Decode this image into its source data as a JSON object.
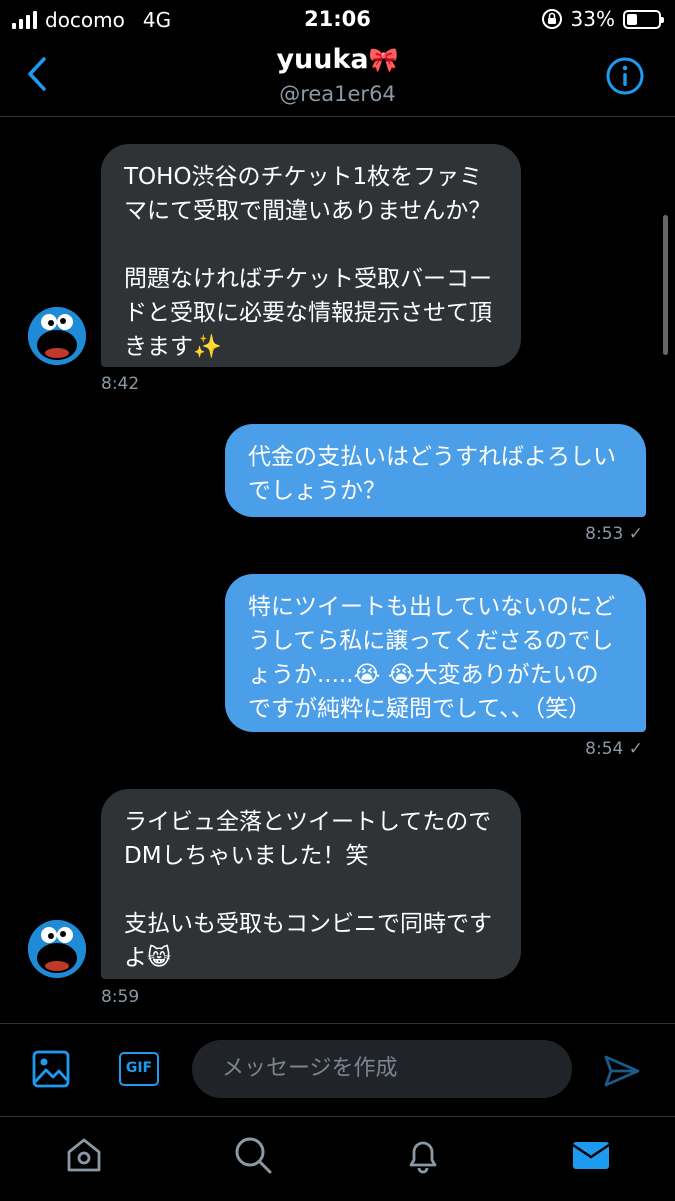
{
  "status": {
    "carrier": "docomo",
    "network": "4G",
    "time": "21:06",
    "battery": "33%",
    "battery_level": 0.33
  },
  "header": {
    "name": "yuuka",
    "name_emoji": "🎀",
    "handle": "@rea1er64"
  },
  "messages": [
    {
      "direction": "in",
      "text": "TOHO渋谷のチケット1枚をファミ\nマにて受取で間違いありませんか？\n\n問題なければチケット受取バーコー\nドと受取に必要な情報提示させて頂\nきます✨",
      "time": "8:42"
    },
    {
      "direction": "out",
      "text": "代金の支払いはどうすればよろしい\nでしょうか？",
      "time": "8:53 ✓"
    },
    {
      "direction": "out",
      "text": "特にツイートも出していないのにど\nうしてら私に譲ってくださるのでし\nょうか.....😭 😭大変ありがたいの\nですが純粋に疑問でして、、（笑）",
      "time": "8:54 ✓"
    },
    {
      "direction": "in",
      "text": "ライビュ全落とツイートしてたので\nDMしちゃいました！笑\n\n支払いも受取もコンビニで同時です\nよ😸",
      "time": "8:59"
    }
  ],
  "composer": {
    "placeholder": "メッセージを作成",
    "gif_label": "GIF"
  },
  "icons": {
    "back": "chevron-left-icon",
    "info": "info-icon",
    "image": "image-icon",
    "send": "send-icon",
    "home": "home-icon",
    "search": "search-icon",
    "notifications": "bell-icon",
    "messages": "mail-icon"
  },
  "colors": {
    "accent": "#1d9bf0",
    "outgoing_bubble": "#4b9ee8",
    "incoming_bubble": "#2f3336",
    "background": "#000000"
  }
}
